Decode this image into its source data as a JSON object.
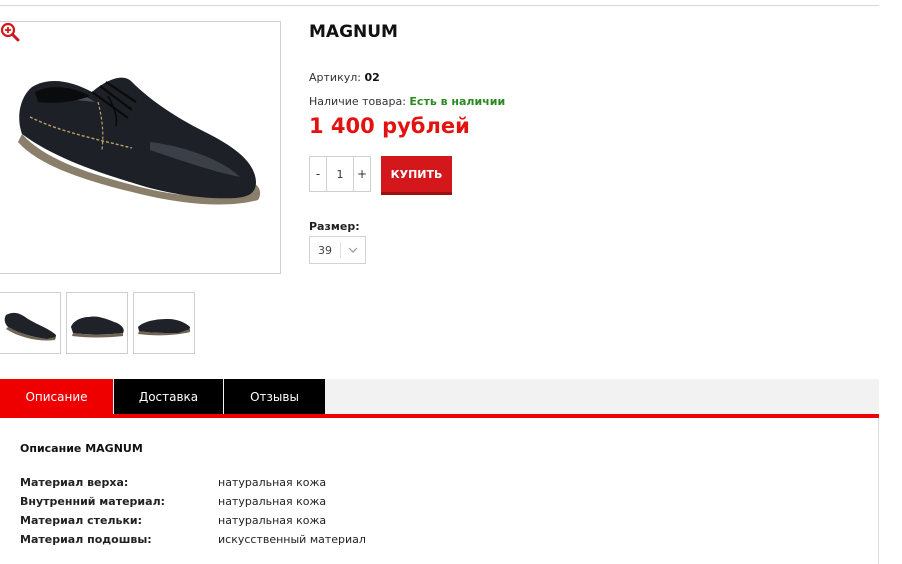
{
  "product": {
    "title": "MAGNUM",
    "sku_label": "Артикул:",
    "sku_value": "02",
    "stock_label": "Наличие товара:",
    "stock_value": "Есть в наличии",
    "price": "1 400 рублей",
    "quantity": "1",
    "minus": "-",
    "plus": "+",
    "buy_label": "КУПИТЬ",
    "size_label": "Размер:",
    "size_value": "39"
  },
  "icons": {
    "zoom": "zoom-in-icon",
    "select": "chevron-down-icon"
  },
  "colors": {
    "accent": "#ef0000",
    "price": "#e3120f",
    "in_stock": "#2a8a1f",
    "buy_button": "#d3171b"
  },
  "tabs": [
    {
      "label": "Описание"
    },
    {
      "label": "Доставка"
    },
    {
      "label": "Отзывы"
    }
  ],
  "description": {
    "title": "Описание MAGNUM",
    "specs": [
      {
        "key": "Материал верха:",
        "value": "натуральная кожа"
      },
      {
        "key": "Внутренний материал:",
        "value": "натуральная кожа"
      },
      {
        "key": "Материал стельки:",
        "value": "натуральная кожа"
      },
      {
        "key": "Материал подошвы:",
        "value": "искусственный материал"
      }
    ]
  }
}
